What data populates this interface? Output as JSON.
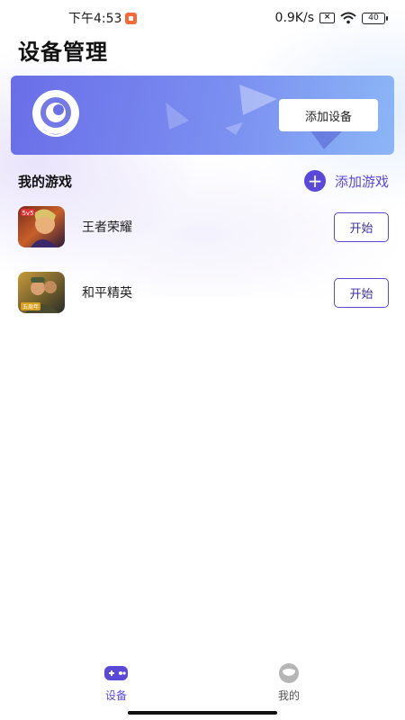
{
  "status_bar": {
    "time": "下午4:53",
    "net_speed": "0.9K/s",
    "sim_label": "×",
    "battery": "40"
  },
  "page": {
    "title": "设备管理"
  },
  "banner": {
    "add_device_label": "添加设备",
    "gradient_start": "#6a6ee8",
    "gradient_end": "#8cb6f6"
  },
  "games_section": {
    "title": "我的游戏",
    "add_game_label": "添加游戏",
    "items": [
      {
        "name": "王者荣耀",
        "icon": "honor-of-kings-icon",
        "start_label": "开始"
      },
      {
        "name": "和平精英",
        "icon": "game-for-peace-icon",
        "start_label": "开始"
      }
    ]
  },
  "bottom_nav": {
    "items": [
      {
        "label": "设备",
        "icon": "gamepad-icon",
        "active": true
      },
      {
        "label": "我的",
        "icon": "profile-icon",
        "active": false
      }
    ]
  },
  "colors": {
    "accent": "#5a49d8"
  }
}
